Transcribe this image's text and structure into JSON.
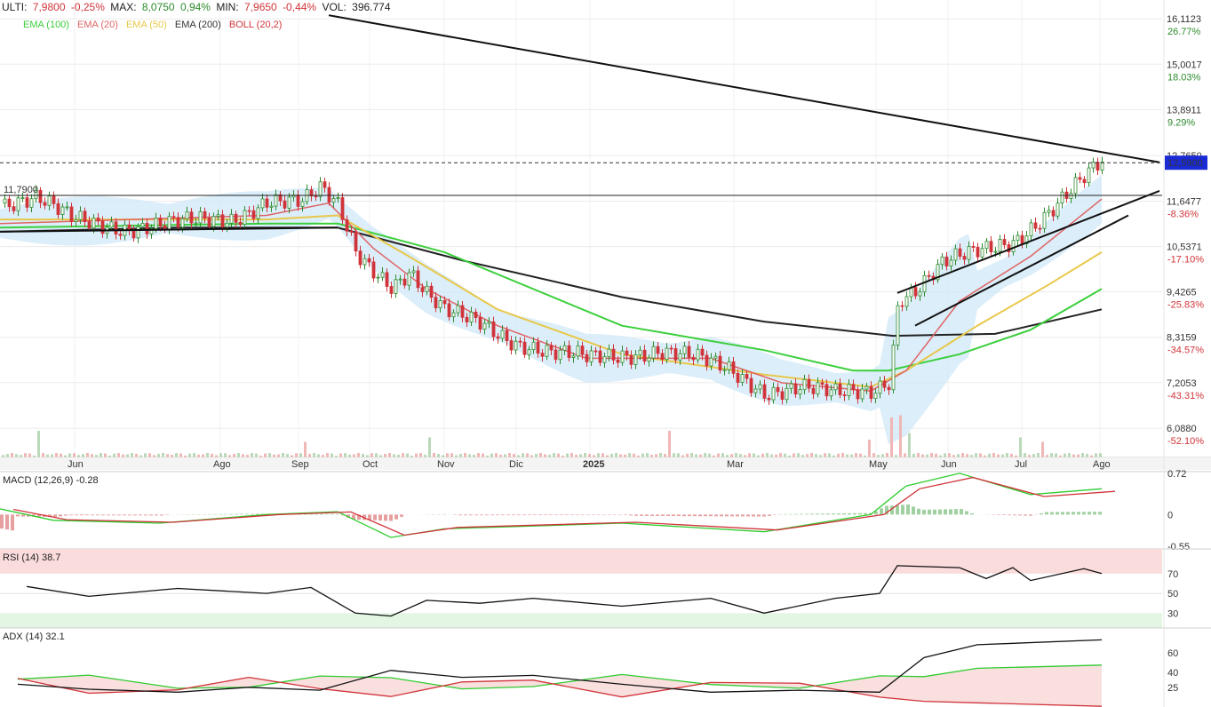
{
  "header": {
    "last_label": "ULTI:",
    "last_value": "7,9800",
    "last_change": "-0,25%",
    "max_label": "MAX:",
    "max_value": "8,0750",
    "max_change": "0,94%",
    "min_label": "MIN:",
    "min_value": "7,9650",
    "min_change": "-0,44%",
    "vol_label": "VOL:",
    "vol_value": "396.774"
  },
  "legend": [
    {
      "label": "EMA (100)",
      "color": "#3ccf3c"
    },
    {
      "label": "EMA (20)",
      "color": "#e06464"
    },
    {
      "label": "EMA (50)",
      "color": "#e8c84a"
    },
    {
      "label": "EMA (200)",
      "color": "#333333"
    },
    {
      "label": "BOLL (20,2)",
      "color": "#d0343a"
    }
  ],
  "colors": {
    "up": "#2e8b2e",
    "down": "#d0343a",
    "band": "#cfe8f8",
    "current": "#1a2bd6"
  },
  "price_axis": {
    "labels": [
      {
        "value": 16.1123,
        "text": "16,1123",
        "pct": "26.77%",
        "sign": "up"
      },
      {
        "value": 15.0017,
        "text": "15,0017",
        "pct": "18.03%",
        "sign": "up"
      },
      {
        "value": 13.8911,
        "text": "13,8911",
        "pct": "9.29%",
        "sign": "up"
      },
      {
        "value": 12.765,
        "text": "12,7650",
        "pct": "",
        "sign": "none"
      },
      {
        "value": 11.6477,
        "text": "11,6477",
        "pct": "-8.36%",
        "sign": "down"
      },
      {
        "value": 10.5371,
        "text": "10,5371",
        "pct": "-17.10%",
        "sign": "down"
      },
      {
        "value": 9.4265,
        "text": "9,4265",
        "pct": "-25.83%",
        "sign": "down"
      },
      {
        "value": 8.3159,
        "text": "8,3159",
        "pct": "-34.57%",
        "sign": "down"
      },
      {
        "value": 7.2053,
        "text": "7,2053",
        "pct": "-43.31%",
        "sign": "down"
      },
      {
        "value": 6.088,
        "text": "6,0880",
        "pct": "-52.10%",
        "sign": "down"
      }
    ],
    "current_value": 12.59,
    "current_text": "12,5900",
    "ref_value": 11.79,
    "ref_text": "11,7900",
    "range": [
      5.7,
      16.4
    ]
  },
  "time_axis": [
    "Jun",
    "Ago",
    "Sep",
    "Oct",
    "Nov",
    "Dic",
    "2025",
    "Mar",
    "May",
    "Jun",
    "Jul",
    "Ago"
  ],
  "panels": {
    "macd": {
      "label": "MACD (12,26,9) -0.28",
      "ticks": [
        "0.72",
        "0",
        "-0.55"
      ]
    },
    "rsi": {
      "label": "RSI (14) 38.7",
      "ticks": [
        "70",
        "50",
        "30"
      ]
    },
    "adx": {
      "label": "ADX (14) 32.1",
      "ticks": [
        "60",
        "40",
        "25"
      ]
    }
  },
  "chart_data": {
    "type": "line",
    "x_start": "May 2024",
    "x_end": "Ago 2025",
    "close_series": {
      "points": [
        [
          0,
          11.6
        ],
        [
          40,
          11.7
        ],
        [
          80,
          11.2
        ],
        [
          140,
          11.0
        ],
        [
          200,
          11.1
        ],
        [
          260,
          11.2
        ],
        [
          300,
          11.7
        ],
        [
          340,
          11.6
        ],
        [
          360,
          11.9
        ],
        [
          380,
          11.5
        ],
        [
          400,
          10.4
        ],
        [
          420,
          10.0
        ],
        [
          440,
          9.6
        ],
        [
          460,
          9.9
        ],
        [
          480,
          9.3
        ],
        [
          500,
          8.9
        ],
        [
          540,
          8.7
        ],
        [
          580,
          8.2
        ],
        [
          620,
          7.9
        ],
        [
          660,
          7.8
        ],
        [
          700,
          7.9
        ],
        [
          740,
          8.0
        ],
        [
          780,
          7.8
        ],
        [
          820,
          7.5
        ],
        [
          860,
          7.0
        ],
        [
          900,
          7.1
        ],
        [
          940,
          6.9
        ],
        [
          980,
          7.0
        ],
        [
          1000,
          7.3
        ],
        [
          1010,
          9.3
        ],
        [
          1030,
          9.5
        ],
        [
          1060,
          10.1
        ],
        [
          1100,
          10.4
        ],
        [
          1140,
          10.7
        ],
        [
          1180,
          11.4
        ],
        [
          1220,
          12.2
        ],
        [
          1240,
          12.59
        ]
      ]
    },
    "ema200_series": {
      "points": [
        [
          0,
          10.9
        ],
        [
          200,
          11.0
        ],
        [
          380,
          11.0
        ],
        [
          520,
          10.2
        ],
        [
          700,
          9.3
        ],
        [
          860,
          8.7
        ],
        [
          1005,
          8.35
        ],
        [
          1120,
          8.4
        ],
        [
          1240,
          9.0
        ]
      ]
    },
    "ema100_series": {
      "points": [
        [
          0,
          11.0
        ],
        [
          300,
          11.1
        ],
        [
          380,
          11.1
        ],
        [
          500,
          10.4
        ],
        [
          700,
          8.6
        ],
        [
          860,
          8.0
        ],
        [
          960,
          7.5
        ],
        [
          1000,
          7.5
        ],
        [
          1080,
          7.9
        ],
        [
          1160,
          8.5
        ],
        [
          1240,
          9.5
        ]
      ]
    },
    "ema50_series": {
      "points": [
        [
          0,
          11.2
        ],
        [
          300,
          11.2
        ],
        [
          380,
          11.3
        ],
        [
          460,
          10.3
        ],
        [
          560,
          9.0
        ],
        [
          700,
          7.9
        ],
        [
          860,
          7.4
        ],
        [
          980,
          7.1
        ],
        [
          1020,
          7.5
        ],
        [
          1100,
          8.6
        ],
        [
          1180,
          9.6
        ],
        [
          1240,
          10.4
        ]
      ]
    },
    "ema20_series": {
      "points": [
        [
          0,
          11.1
        ],
        [
          300,
          11.3
        ],
        [
          370,
          11.6
        ],
        [
          420,
          10.5
        ],
        [
          480,
          9.5
        ],
        [
          560,
          8.6
        ],
        [
          660,
          7.8
        ],
        [
          800,
          7.8
        ],
        [
          880,
          7.2
        ],
        [
          980,
          7.0
        ],
        [
          1020,
          7.5
        ],
        [
          1080,
          9.2
        ],
        [
          1160,
          10.3
        ],
        [
          1240,
          11.7
        ]
      ]
    },
    "trendlines": [
      {
        "from": [
          370,
          16.2
        ],
        "to": [
          1305,
          12.6
        ]
      },
      {
        "from": [
          1010,
          9.4
        ],
        "to": [
          1305,
          11.9
        ]
      },
      {
        "from": [
          1030,
          8.6
        ],
        "to": [
          1270,
          11.3
        ]
      },
      {
        "from": [
          0,
          10.9
        ],
        "to": [
          380,
          11.0
        ]
      }
    ],
    "volume": {
      "baseline_pct": 0.04,
      "spikes": [
        [
          40,
          0.6
        ],
        [
          340,
          0.35
        ],
        [
          480,
          0.45
        ],
        [
          750,
          0.6
        ],
        [
          975,
          0.4
        ],
        [
          1000,
          0.9
        ],
        [
          1010,
          0.95
        ],
        [
          1020,
          0.55
        ],
        [
          1145,
          0.45
        ],
        [
          1170,
          0.35
        ]
      ]
    },
    "macd_series": {
      "points": [
        [
          0,
          0.1
        ],
        [
          60,
          -0.1
        ],
        [
          180,
          -0.15
        ],
        [
          300,
          0.0
        ],
        [
          380,
          0.05
        ],
        [
          440,
          -0.4
        ],
        [
          500,
          -0.25
        ],
        [
          700,
          -0.15
        ],
        [
          860,
          -0.3
        ],
        [
          980,
          0.0
        ],
        [
          1020,
          0.5
        ],
        [
          1080,
          0.72
        ],
        [
          1160,
          0.35
        ],
        [
          1240,
          0.45
        ]
      ]
    },
    "rsi_series": {
      "points": [
        [
          30,
          57
        ],
        [
          100,
          47
        ],
        [
          200,
          55
        ],
        [
          300,
          50
        ],
        [
          350,
          56
        ],
        [
          400,
          30
        ],
        [
          440,
          27
        ],
        [
          480,
          43
        ],
        [
          540,
          40
        ],
        [
          600,
          45
        ],
        [
          700,
          37
        ],
        [
          800,
          45
        ],
        [
          860,
          30
        ],
        [
          940,
          45
        ],
        [
          990,
          50
        ],
        [
          1010,
          78
        ],
        [
          1080,
          76
        ],
        [
          1110,
          65
        ],
        [
          1140,
          76
        ],
        [
          1160,
          63
        ],
        [
          1220,
          75
        ],
        [
          1240,
          70
        ]
      ]
    },
    "adx_series": {
      "points": [
        [
          20,
          28
        ],
        [
          100,
          23
        ],
        [
          200,
          20
        ],
        [
          280,
          25
        ],
        [
          360,
          22
        ],
        [
          440,
          42
        ],
        [
          520,
          35
        ],
        [
          600,
          37
        ],
        [
          700,
          28
        ],
        [
          800,
          20
        ],
        [
          900,
          22
        ],
        [
          990,
          20
        ],
        [
          1040,
          55
        ],
        [
          1100,
          68
        ],
        [
          1240,
          73
        ]
      ]
    }
  }
}
